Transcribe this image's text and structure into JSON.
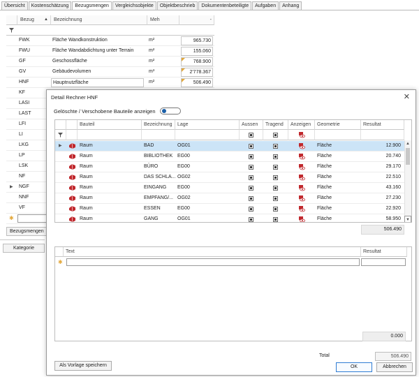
{
  "tabs": [
    "Übersicht",
    "Kostenschätzung",
    "Bezugsmengen",
    "Vergleichsobjekte",
    "Objektbeschrieb",
    "Dokumentenbeteiligte",
    "Aufgaben",
    "Anhang"
  ],
  "active_tab": "Bezugsmengen",
  "background": {
    "headers": {
      "bezug": "Bezug",
      "bezeichnung": "Bezeichnung",
      "meh": "Meh",
      "value": "-"
    },
    "rows": [
      {
        "bezug": "FWK",
        "bezeichnung": "Fläche Wandkonstruktion",
        "meh": "m²",
        "value": "965.730"
      },
      {
        "bezug": "FWU",
        "bezeichnung": "Fläche Wandabdichtung unter Terrain",
        "meh": "m²",
        "value": "155.060"
      },
      {
        "bezug": "GF",
        "bezeichnung": "Geschossfläche",
        "meh": "m²",
        "value": "768.900"
      },
      {
        "bezug": "GV",
        "bezeichnung": "Gebäudevolumen",
        "meh": "m³",
        "value": "2'778.367"
      },
      {
        "bezug": "HNF",
        "bezeichnung": "Hauptnutzfläche",
        "meh": "m²",
        "value": "506.490"
      },
      {
        "bezug": "KF"
      },
      {
        "bezug": "LASI"
      },
      {
        "bezug": "LAST"
      },
      {
        "bezug": "LFI"
      },
      {
        "bezug": "LI"
      },
      {
        "bezug": "LKG"
      },
      {
        "bezug": "LP"
      },
      {
        "bezug": "LSK"
      },
      {
        "bezug": "NF"
      },
      {
        "bezug": "NGF"
      },
      {
        "bezug": "NNF"
      },
      {
        "bezug": "VF"
      }
    ],
    "button_bezugsmengen": "Bezugsmengen",
    "button_kategorie": "Kategorie"
  },
  "dialog": {
    "title": "Detail Rechner HNF",
    "toggle_label": "Gelöschte / Verschobene Bauteile anzeigen",
    "grid": {
      "headers": {
        "bauteil": "Bauteil",
        "bezeichnung": "Bezeichnung",
        "lage": "Lage",
        "aussen": "Aussen",
        "tragend": "Tragend",
        "anzeigen": "Anzeigen",
        "geometrie": "Geometrie",
        "resultat": "Resultat"
      },
      "rows": [
        {
          "bauteil": "Raum",
          "bezeichnung": "BAD",
          "lage": "OG01",
          "geometrie": "Fläche",
          "resultat": "12.900"
        },
        {
          "bauteil": "Raum",
          "bezeichnung": "BIBLIOTHEK",
          "lage": "EG00",
          "geometrie": "Fläche",
          "resultat": "20.740"
        },
        {
          "bauteil": "Raum",
          "bezeichnung": "BÜRO",
          "lage": "EG00",
          "geometrie": "Fläche",
          "resultat": "29.170"
        },
        {
          "bauteil": "Raum",
          "bezeichnung": "DAS SCHLA...",
          "lage": "OG02",
          "geometrie": "Fläche",
          "resultat": "22.510"
        },
        {
          "bauteil": "Raum",
          "bezeichnung": "EINGANG",
          "lage": "EG00",
          "geometrie": "Fläche",
          "resultat": "43.160"
        },
        {
          "bauteil": "Raum",
          "bezeichnung": "EMPFANG/...",
          "lage": "OG02",
          "geometrie": "Fläche",
          "resultat": "27.230"
        },
        {
          "bauteil": "Raum",
          "bezeichnung": "ESSEN",
          "lage": "EG00",
          "geometrie": "Fläche",
          "resultat": "22.920"
        },
        {
          "bauteil": "Raum",
          "bezeichnung": "GANG",
          "lage": "OG01",
          "geometrie": "Fläche",
          "resultat": "58.950"
        }
      ],
      "sum": "506.490"
    },
    "text_grid": {
      "headers": {
        "text": "Text",
        "resultat": "Resultat"
      },
      "sum": "0.000"
    },
    "total_label": "Total",
    "total_value": "506.490",
    "buttons": {
      "save_template": "Als Vorlage speichern",
      "ok": "OK",
      "cancel": "Abbrechen"
    }
  },
  "colors": {
    "accent": "#1b5fa8",
    "selected_row": "#cce4f7",
    "raum_icon": "#c0282d",
    "warning_marker": "#e3a83b"
  }
}
